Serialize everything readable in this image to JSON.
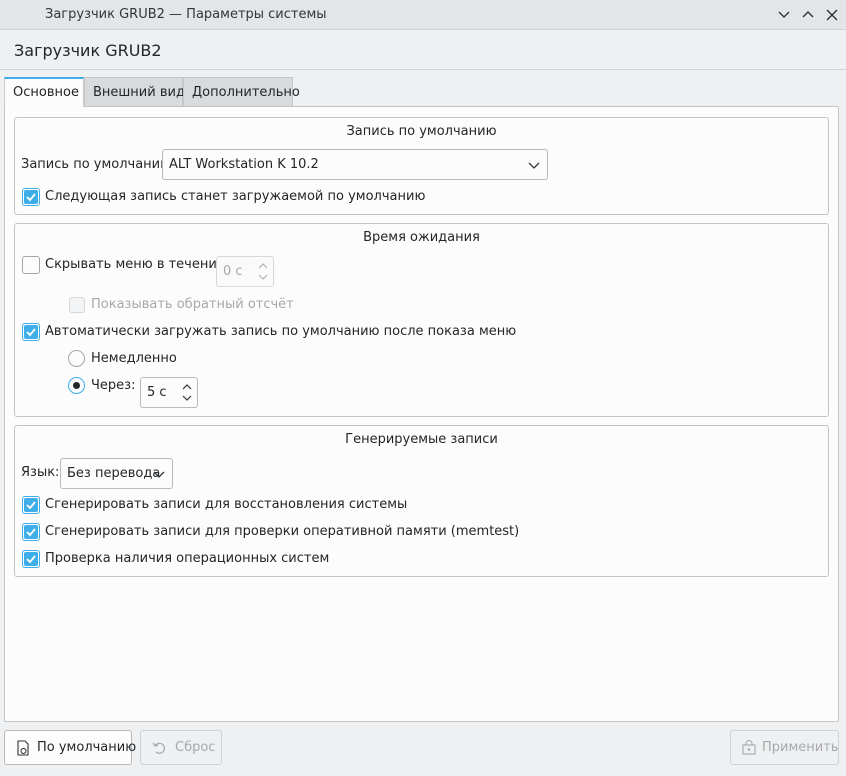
{
  "window": {
    "title": "Загрузчик GRUB2 — Параметры системы"
  },
  "header": {
    "title": "Загрузчик GRUB2"
  },
  "tabs": [
    {
      "label": "Основное",
      "active": true
    },
    {
      "label": "Внешний вид",
      "active": false
    },
    {
      "label": "Дополнительно",
      "active": false
    }
  ],
  "default_entry": {
    "group_title": "Запись по умолчанию",
    "label": "Запись по умолчанию:",
    "value": "ALT Workstation K 10.2",
    "next_entry_checkbox": {
      "label": "Следующая запись станет загружаемой по умолчанию",
      "checked": true
    }
  },
  "timeout": {
    "group_title": "Время ожидания",
    "hide_menu": {
      "label": "Скрывать меню в течение:",
      "checked": false
    },
    "hide_menu_value": "0 с",
    "show_countdown": {
      "label": "Показывать обратный отсчёт",
      "checked": false,
      "enabled": false
    },
    "auto_boot": {
      "label": "Автоматически загружать запись по умолчанию после показа меню",
      "checked": true
    },
    "immediately": {
      "label": "Немедленно",
      "selected": false
    },
    "after": {
      "label": "Через:",
      "selected": true
    },
    "after_value": "5 с"
  },
  "generated": {
    "group_title": "Генерируемые записи",
    "language_label": "Язык:",
    "language_value": "Без перевода",
    "recovery": {
      "label": "Сгенерировать записи для восстановления системы",
      "checked": true
    },
    "memtest": {
      "label": "Сгенерировать записи для проверки оперативной памяти (memtest)",
      "checked": true
    },
    "os_prober": {
      "label": "Проверка наличия операционных систем",
      "checked": true
    }
  },
  "footer": {
    "defaults_label": "По умолчанию",
    "reset_label": "Сброс",
    "apply_label": "Применить"
  },
  "colors": {
    "accent": "#3daee9",
    "window_bg": "#eff0f1",
    "panel_bg": "#fcfcfc"
  }
}
